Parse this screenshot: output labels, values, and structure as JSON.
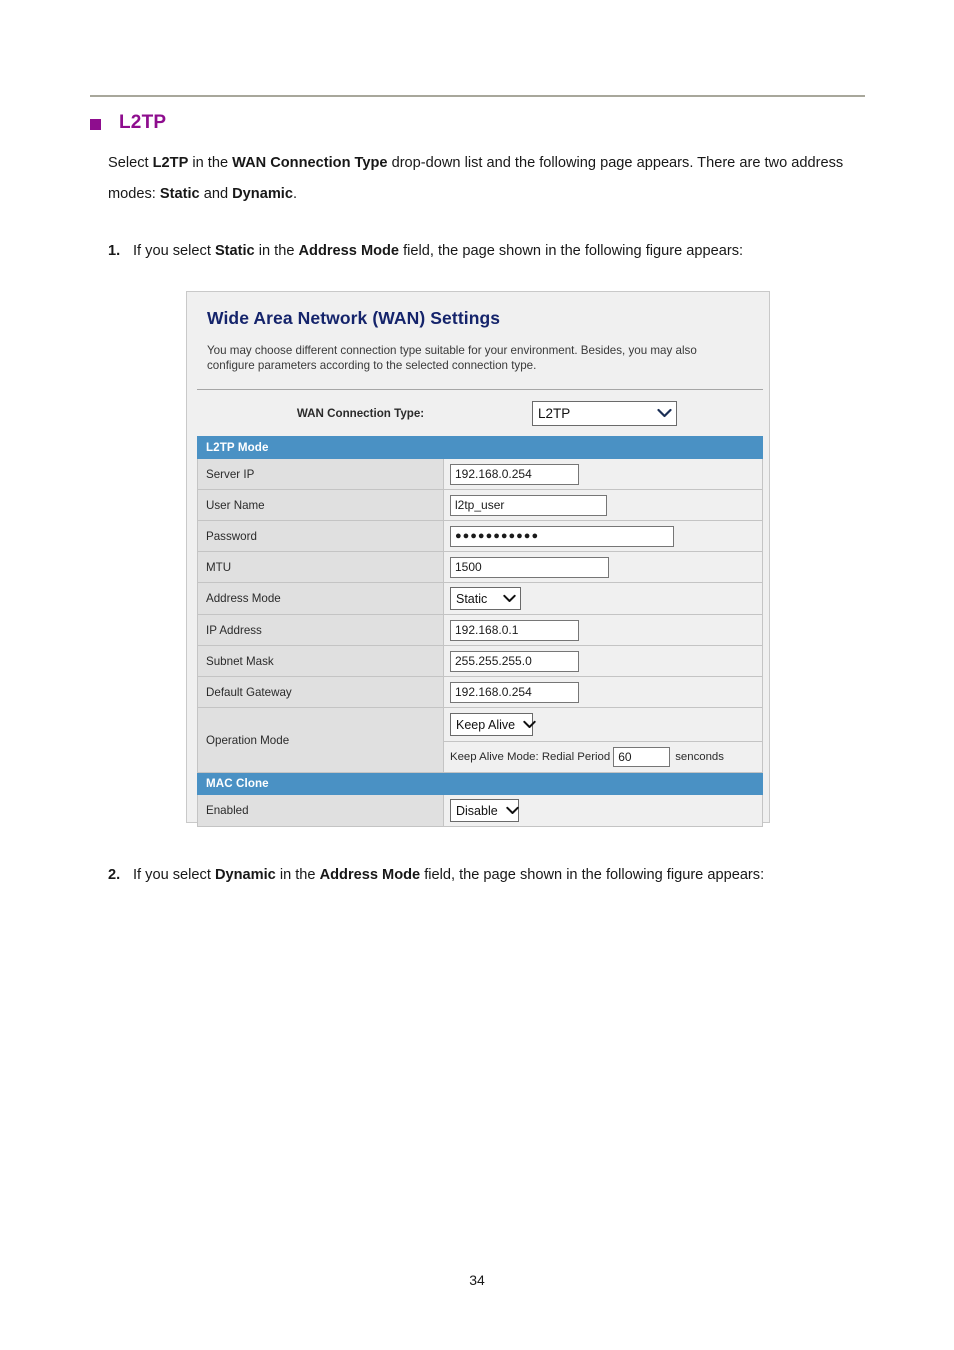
{
  "document": {
    "heading": "L2TP",
    "bullet_color": "#8e0d8e",
    "intro": {
      "part1": "Select ",
      "bold1": "L2TP",
      "part2": " in the ",
      "bold2": "WAN Connection Type",
      "part3": " drop-down list and the following page appears. There are two address modes: ",
      "bold3": "Static",
      "part4": " and ",
      "bold4": "Dynamic",
      "part5": "."
    },
    "step1": {
      "number": "1.",
      "part1": "If you select ",
      "bold1": "Static",
      "part2": " in the ",
      "bold2": "Address Mode",
      "part3": " field, the page shown in the following figure appears:"
    },
    "step2": {
      "number": "2.",
      "part1": "If you select ",
      "bold1": "Dynamic",
      "part2": " in the ",
      "bold2": "Address Mode",
      "part3": " field, the page shown in the following figure appears:"
    },
    "page_number": "34"
  },
  "panel": {
    "title": "Wide Area Network (WAN) Settings",
    "description": "You may choose different connection type suitable for your environment. Besides, you may also configure parameters according to the selected connection type.",
    "title_color": "#15246b",
    "section_bar_color": "#4a91c4",
    "connection_type": {
      "label": "WAN Connection Type:",
      "value": "L2TP"
    },
    "sections": [
      {
        "name": "L2TP Mode",
        "rows": [
          {
            "label": "Server IP",
            "control": "text",
            "value": "192.168.0.254"
          },
          {
            "label": "User Name",
            "control": "text",
            "value": "l2tp_user"
          },
          {
            "label": "Password",
            "control": "text",
            "value": "●●●●●●●●●●●"
          },
          {
            "label": "MTU",
            "control": "text",
            "value": "1500"
          },
          {
            "label": "Address Mode",
            "control": "select",
            "value": "Static"
          },
          {
            "label": "IP Address",
            "control": "text",
            "value": "192.168.0.1"
          },
          {
            "label": "Subnet Mask",
            "control": "text",
            "value": "255.255.255.0"
          },
          {
            "label": "Default Gateway",
            "control": "text",
            "value": "192.168.0.254"
          }
        ]
      },
      {
        "name": "MAC Clone",
        "rows": [
          {
            "label": "Enabled",
            "control": "select",
            "value": "Disable"
          }
        ]
      }
    ],
    "operation_mode": {
      "label": "Operation Mode",
      "mode_value": "Keep Alive",
      "keepalive_prefix": "Keep Alive Mode: Redial Period",
      "redial_period": "60",
      "keepalive_suffix": "senconds"
    }
  }
}
